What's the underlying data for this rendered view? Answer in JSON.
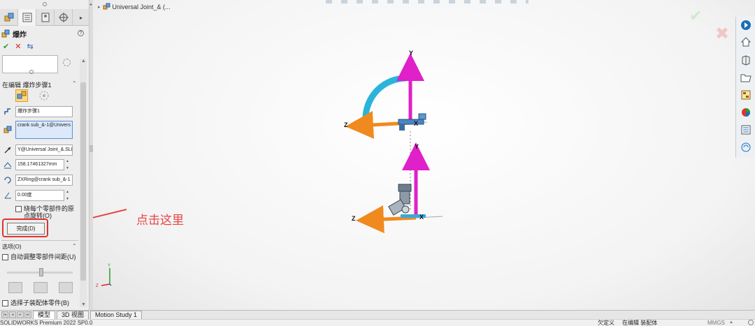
{
  "property_manager": {
    "title": "爆炸",
    "help": "?",
    "section_title": "在编辑 爆炸步骤1",
    "step_name": "爆炸步骤1",
    "components": "crank sub_&-1@Univers",
    "direction": "Y@Universal Joint_&.SLI",
    "distance": "158.17461327mm",
    "rotation_axis": "ZXRing@crank sub_&-1",
    "angle": "0.00度",
    "rotate_about_origin_label": "绕每个零部件的原点旋转(O)",
    "done_button": "完成(D)",
    "options_title": "选项(O)",
    "auto_space_label": "自动调整零部件间距(U)",
    "select_subassembly_label": "选择子装配体零件(B)"
  },
  "graphics": {
    "tree_label": "Universal Joint_& (...",
    "annotation": "点击这里",
    "axis_labels": {
      "y": "Y",
      "z": "Z",
      "x": "X"
    }
  },
  "bottom_tabs": [
    "模型",
    "3D 视图",
    "Motion Study 1"
  ],
  "status": {
    "app": "SOLIDWORKS Premium 2022 SP0.0",
    "defined": "欠定义",
    "mode": "在编辑 装配体",
    "units": "MMGS"
  },
  "colors": {
    "annotation": "#e84444",
    "triad_y": "#e020c8",
    "triad_z": "#f08a1e",
    "rotation_ring": "#2ab4dc"
  }
}
